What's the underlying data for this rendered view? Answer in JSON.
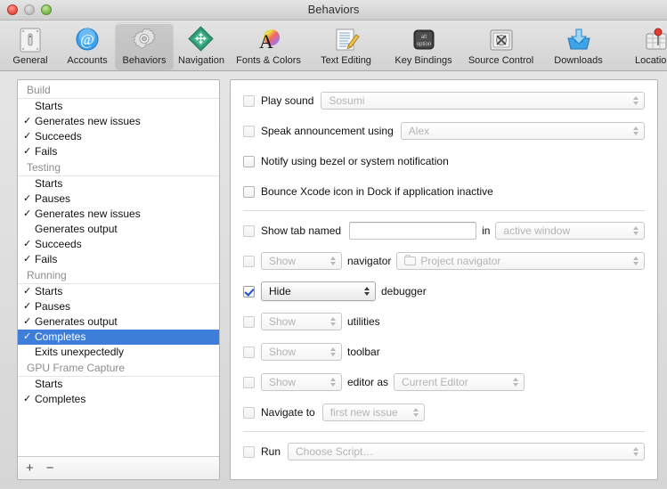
{
  "window": {
    "title": "Behaviors",
    "traffic_lights": [
      "close-button",
      "minimize-button",
      "zoom-button"
    ]
  },
  "toolbar": {
    "selected": "Behaviors",
    "items": [
      {
        "label": "General",
        "icon": "general-icon"
      },
      {
        "label": "Accounts",
        "icon": "accounts-at-icon"
      },
      {
        "label": "Behaviors",
        "icon": "behaviors-gear-icon"
      },
      {
        "label": "Navigation",
        "icon": "navigation-diamond-icon"
      },
      {
        "label": "Fonts & Colors",
        "icon": "fonts-colors-icon"
      },
      {
        "label": "Text Editing",
        "icon": "text-editing-pencil-icon"
      },
      {
        "label": "Key Bindings",
        "icon": "key-bindings-key-icon"
      },
      {
        "label": "Source Control",
        "icon": "source-control-safe-icon"
      },
      {
        "label": "Downloads",
        "icon": "downloads-arrow-icon"
      },
      {
        "label": "Locations",
        "icon": "locations-pin-icon"
      }
    ]
  },
  "sidebar": {
    "groups": [
      {
        "name": "Build",
        "items": [
          {
            "label": "Starts",
            "checked": false,
            "selected": false
          },
          {
            "label": "Generates new issues",
            "checked": true,
            "selected": false
          },
          {
            "label": "Succeeds",
            "checked": true,
            "selected": false
          },
          {
            "label": "Fails",
            "checked": true,
            "selected": false
          }
        ]
      },
      {
        "name": "Testing",
        "items": [
          {
            "label": "Starts",
            "checked": false,
            "selected": false
          },
          {
            "label": "Pauses",
            "checked": true,
            "selected": false
          },
          {
            "label": "Generates new issues",
            "checked": true,
            "selected": false
          },
          {
            "label": "Generates output",
            "checked": false,
            "selected": false
          },
          {
            "label": "Succeeds",
            "checked": true,
            "selected": false
          },
          {
            "label": "Fails",
            "checked": true,
            "selected": false
          }
        ]
      },
      {
        "name": "Running",
        "items": [
          {
            "label": "Starts",
            "checked": true,
            "selected": false
          },
          {
            "label": "Pauses",
            "checked": true,
            "selected": false
          },
          {
            "label": "Generates output",
            "checked": true,
            "selected": false
          },
          {
            "label": "Completes",
            "checked": true,
            "selected": true
          },
          {
            "label": "Exits unexpectedly",
            "checked": false,
            "selected": false
          }
        ]
      },
      {
        "name": "GPU Frame Capture",
        "items": [
          {
            "label": "Starts",
            "checked": false,
            "selected": false
          },
          {
            "label": "Completes",
            "checked": true,
            "selected": false
          }
        ]
      }
    ],
    "footer": {
      "add_label": "+",
      "remove_label": "−"
    }
  },
  "detail": {
    "rows": {
      "play_sound": {
        "checkbox_label": "Play sound",
        "checked": false,
        "popup_value": "Sosumi",
        "popup_enabled": false
      },
      "speak_announcement": {
        "checkbox_label": "Speak announcement using",
        "checked": false,
        "popup_value": "Alex",
        "popup_enabled": false
      },
      "notify_bezel": {
        "checkbox_label": "Notify using bezel or system notification",
        "checked": false
      },
      "bounce_dock": {
        "checkbox_label": "Bounce Xcode icon in Dock if application inactive",
        "checked": false
      },
      "show_tab_named": {
        "checkbox_label": "Show tab named",
        "checked": false,
        "field_value": "",
        "field_placeholder": "",
        "in_label": "in",
        "popup_value": "active window",
        "popup_enabled": false
      },
      "navigator": {
        "checked": false,
        "action_value": "Show",
        "action_enabled": false,
        "label": "navigator",
        "target_value": "Project navigator",
        "target_enabled": false,
        "target_icon": "folder-icon"
      },
      "debugger": {
        "checked": true,
        "action_value": "Hide",
        "action_enabled": true,
        "label": "debugger"
      },
      "utilities": {
        "checked": false,
        "action_value": "Show",
        "action_enabled": false,
        "label": "utilities"
      },
      "toolbar": {
        "checked": false,
        "action_value": "Show",
        "action_enabled": false,
        "label": "toolbar"
      },
      "editor": {
        "checked": false,
        "action_value": "Show",
        "action_enabled": false,
        "label": "editor as",
        "target_value": "Current Editor",
        "target_enabled": false
      },
      "navigate_to": {
        "checkbox_label": "Navigate to",
        "checked": false,
        "popup_value": "first new issue",
        "popup_enabled": false
      },
      "run": {
        "checkbox_label": "Run",
        "checked": false,
        "popup_value": "Choose Script…",
        "popup_enabled": false
      }
    }
  },
  "colors": {
    "selection_blue": "#3d7edb",
    "checkmark_blue": "#1c4fd8",
    "disabled_text": "#b0b0b0",
    "group_header_text": "#8d8d8d"
  }
}
